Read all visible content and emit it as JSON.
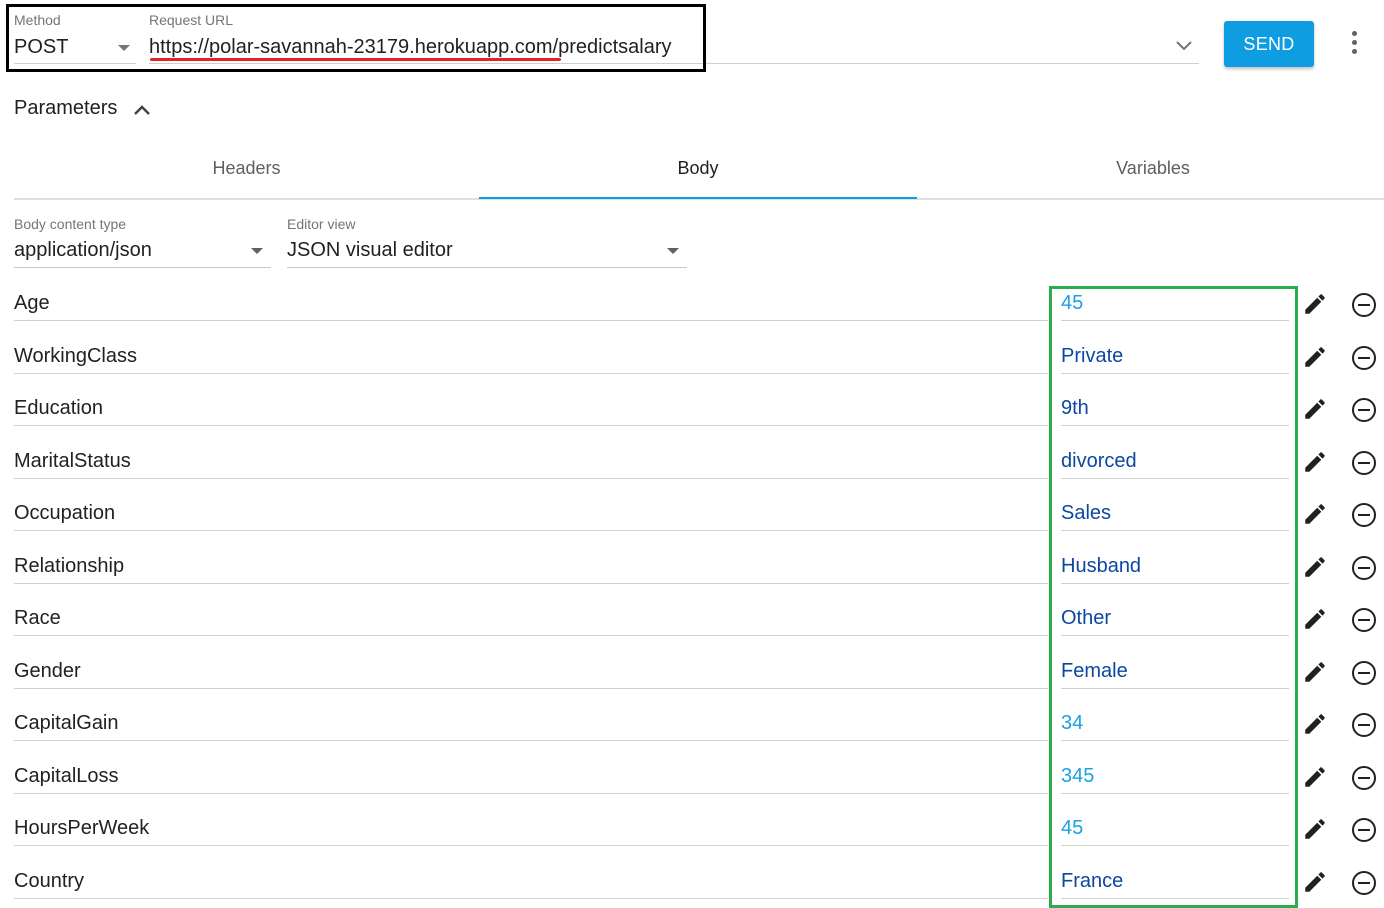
{
  "request": {
    "method_label": "Method",
    "method_value": "POST",
    "url_label": "Request URL",
    "url_value": "https://polar-savannah-23179.herokuapp.com/predictsalary",
    "send_label": "SEND"
  },
  "parameters": {
    "title": "Parameters",
    "tabs": [
      {
        "label": "Headers",
        "active": false
      },
      {
        "label": "Body",
        "active": true
      },
      {
        "label": "Variables",
        "active": false
      }
    ],
    "body_content_type_label": "Body content type",
    "body_content_type_value": "application/json",
    "editor_view_label": "Editor view",
    "editor_view_value": "JSON visual editor"
  },
  "rows": [
    {
      "name": "Age",
      "value": "45",
      "type": "number"
    },
    {
      "name": "WorkingClass",
      "value": "Private",
      "type": "string"
    },
    {
      "name": "Education",
      "value": "9th",
      "type": "string"
    },
    {
      "name": "MaritalStatus",
      "value": "divorced",
      "type": "string"
    },
    {
      "name": "Occupation",
      "value": "Sales",
      "type": "string"
    },
    {
      "name": "Relationship",
      "value": "Husband",
      "type": "string"
    },
    {
      "name": "Race",
      "value": "Other",
      "type": "string"
    },
    {
      "name": "Gender",
      "value": "Female",
      "type": "string"
    },
    {
      "name": "CapitalGain",
      "value": "34",
      "type": "number"
    },
    {
      "name": "CapitalLoss",
      "value": "345",
      "type": "number"
    },
    {
      "name": "HoursPerWeek",
      "value": "45",
      "type": "number"
    },
    {
      "name": "Country",
      "value": "France",
      "type": "string"
    }
  ],
  "colors": {
    "accent": "#0e9de0",
    "number_value": "#1ba1e2",
    "string_value": "#0d47a1",
    "url_annotation_box": "#000000",
    "url_underline_annotation": "#e02424",
    "values_annotation_box": "#2eaa4f"
  },
  "icons": {
    "method_dropdown": "caret-down-icon",
    "url_history": "chevron-down-icon",
    "more": "more-vert-icon",
    "parameters_toggle": "chevron-up-icon",
    "row_edit": "pencil-icon",
    "row_remove": "remove-circle-icon"
  }
}
